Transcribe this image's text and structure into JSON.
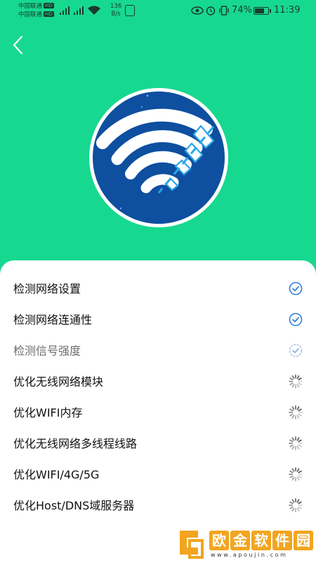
{
  "status_bar": {
    "carrier_1": "中国联通",
    "carrier_2": "中国联通",
    "hd_badge": "HD",
    "network_type": "4G",
    "net_speed_value": "136",
    "net_speed_unit": "B/s",
    "battery_percent": "74%",
    "battery_level": 0.74,
    "time": "11:39",
    "icons": [
      "signal-icon",
      "wifi-icon",
      "app-notification-icon",
      "eye-icon",
      "alarm-icon",
      "vibrate-icon",
      "battery-icon"
    ]
  },
  "header": {
    "back_icon": "chevron-left-icon"
  },
  "hero": {
    "icon": "wifi-logo-icon",
    "colors": {
      "background": "#17d88f",
      "circle": "#0e4fa0",
      "accent": "#2aa6e8"
    }
  },
  "tasks": [
    {
      "label": "检测网络设置",
      "state": "done"
    },
    {
      "label": "检测网络连通性",
      "state": "done"
    },
    {
      "label": "检测信号强度",
      "state": "in-progress"
    },
    {
      "label": "优化无线网络模块",
      "state": "pending"
    },
    {
      "label": "优化WIFI内存",
      "state": "pending"
    },
    {
      "label": "优化无线网络多线程线路",
      "state": "pending"
    },
    {
      "label": "优化WIFI/4G/5G",
      "state": "pending"
    },
    {
      "label": "优化Host/DNS域服务器",
      "state": "pending"
    }
  ],
  "watermark": {
    "chars": [
      "欧",
      "金",
      "软",
      "件",
      "园"
    ],
    "url": "www.apoujin.com"
  }
}
